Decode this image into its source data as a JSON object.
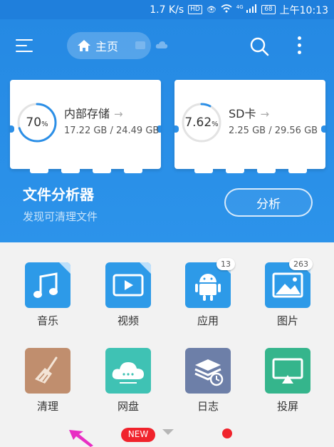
{
  "status_bar": {
    "speed": "1.7 K/s",
    "hd": "HD",
    "signal_label": "4G",
    "battery": "68",
    "time": "上午10:13"
  },
  "header": {
    "home_label": "主页",
    "icons": [
      "menu-icon",
      "home-icon",
      "folder-icon",
      "cloud-icon",
      "search-icon",
      "more-icon"
    ]
  },
  "storage": [
    {
      "name": "内部存储",
      "percent": "70",
      "percent_unit": "%",
      "used_fraction": 0.7,
      "size": "17.22 GB / 24.49 GB"
    },
    {
      "name": "SD卡",
      "percent": "7.62",
      "percent_unit": "%",
      "used_fraction": 0.0762,
      "size": "2.25 GB / 29.56 GB"
    }
  ],
  "analyzer": {
    "title": "文件分析器",
    "subtitle": "发现可清理文件",
    "button": "分析"
  },
  "categories": [
    {
      "label": "音乐",
      "icon": "music-icon",
      "color": "#2d9ae8"
    },
    {
      "label": "视频",
      "icon": "video-icon",
      "color": "#2d9ae8"
    },
    {
      "label": "应用",
      "icon": "android-icon",
      "color": "#2d9ae8",
      "count": "13"
    },
    {
      "label": "图片",
      "icon": "picture-icon",
      "color": "#2d9ae8",
      "count": "263"
    },
    {
      "label": "清理",
      "icon": "broom-icon",
      "color": "#c08e6e"
    },
    {
      "label": "网盘",
      "icon": "cloud-drive-icon",
      "color": "#3fc2b4",
      "badge": "NEW"
    },
    {
      "label": "日志",
      "icon": "log-icon",
      "color": "#6d7fa8"
    },
    {
      "label": "投屏",
      "icon": "cast-icon",
      "color": "#35b58c"
    }
  ],
  "colors": {
    "primary": "#2b8fe7",
    "accent": "#f0232c"
  }
}
